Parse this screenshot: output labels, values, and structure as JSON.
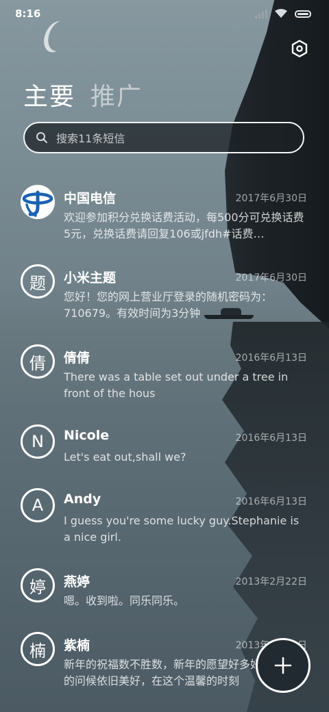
{
  "status_bar": {
    "time": "8:16",
    "icons": [
      "signal-icon",
      "wifi-icon",
      "battery-icon"
    ]
  },
  "header": {
    "settings_icon": "settings-hexagon-icon",
    "tabs": [
      {
        "label": "主要",
        "active": true
      },
      {
        "label": "推广",
        "active": false
      }
    ]
  },
  "search": {
    "placeholder": "搜索11条短信",
    "icon": "search-icon"
  },
  "messages": [
    {
      "name": "中国电信",
      "date": "2017年6月30日",
      "preview": "欢迎参加积分兑换话费活动，每500分可兑换话费5元，兑换话费请回复106或jfdh#话费…",
      "avatar_type": "logo",
      "avatar_icon": "china-telecom-logo-icon",
      "avatar_color": "#1a63b3"
    },
    {
      "name": "小米主题",
      "date": "2017年6月30日",
      "preview": "您好！您的网上营业厅登录的随机密码为：710679。有效时间为3分钟",
      "avatar_type": "letter",
      "avatar_text": "题"
    },
    {
      "name": "倩倩",
      "date": "2016年6月13日",
      "preview": "There was a table set out under a tree in front of the hous",
      "avatar_type": "letter",
      "avatar_text": "倩"
    },
    {
      "name": "Nicole",
      "date": "2016年6月13日",
      "preview": "Let's eat out,shall we?",
      "avatar_type": "letter",
      "avatar_text": "N"
    },
    {
      "name": "Andy",
      "date": "2016年6月13日",
      "preview": "I guess you're some lucky guy.Stephanie is a nice girl.",
      "avatar_type": "letter",
      "avatar_text": "A"
    },
    {
      "name": "燕婷",
      "date": "2013年2月22日",
      "preview": "嗯。收到啦。同乐同乐。",
      "avatar_type": "letter",
      "avatar_text": "婷"
    },
    {
      "name": "紫楠",
      "date": "2013年2月22日",
      "preview": "新年的祝福数不胜数，新年的愿望好多好多，新年的问候依旧美好，在这个温馨的时刻",
      "avatar_type": "letter",
      "avatar_text": "楠"
    }
  ],
  "fab": {
    "icon": "plus-icon"
  },
  "colors": {
    "text_primary": "#ffffff",
    "fab_background": "#202a30",
    "telecom_blue": "#1a63b3"
  }
}
